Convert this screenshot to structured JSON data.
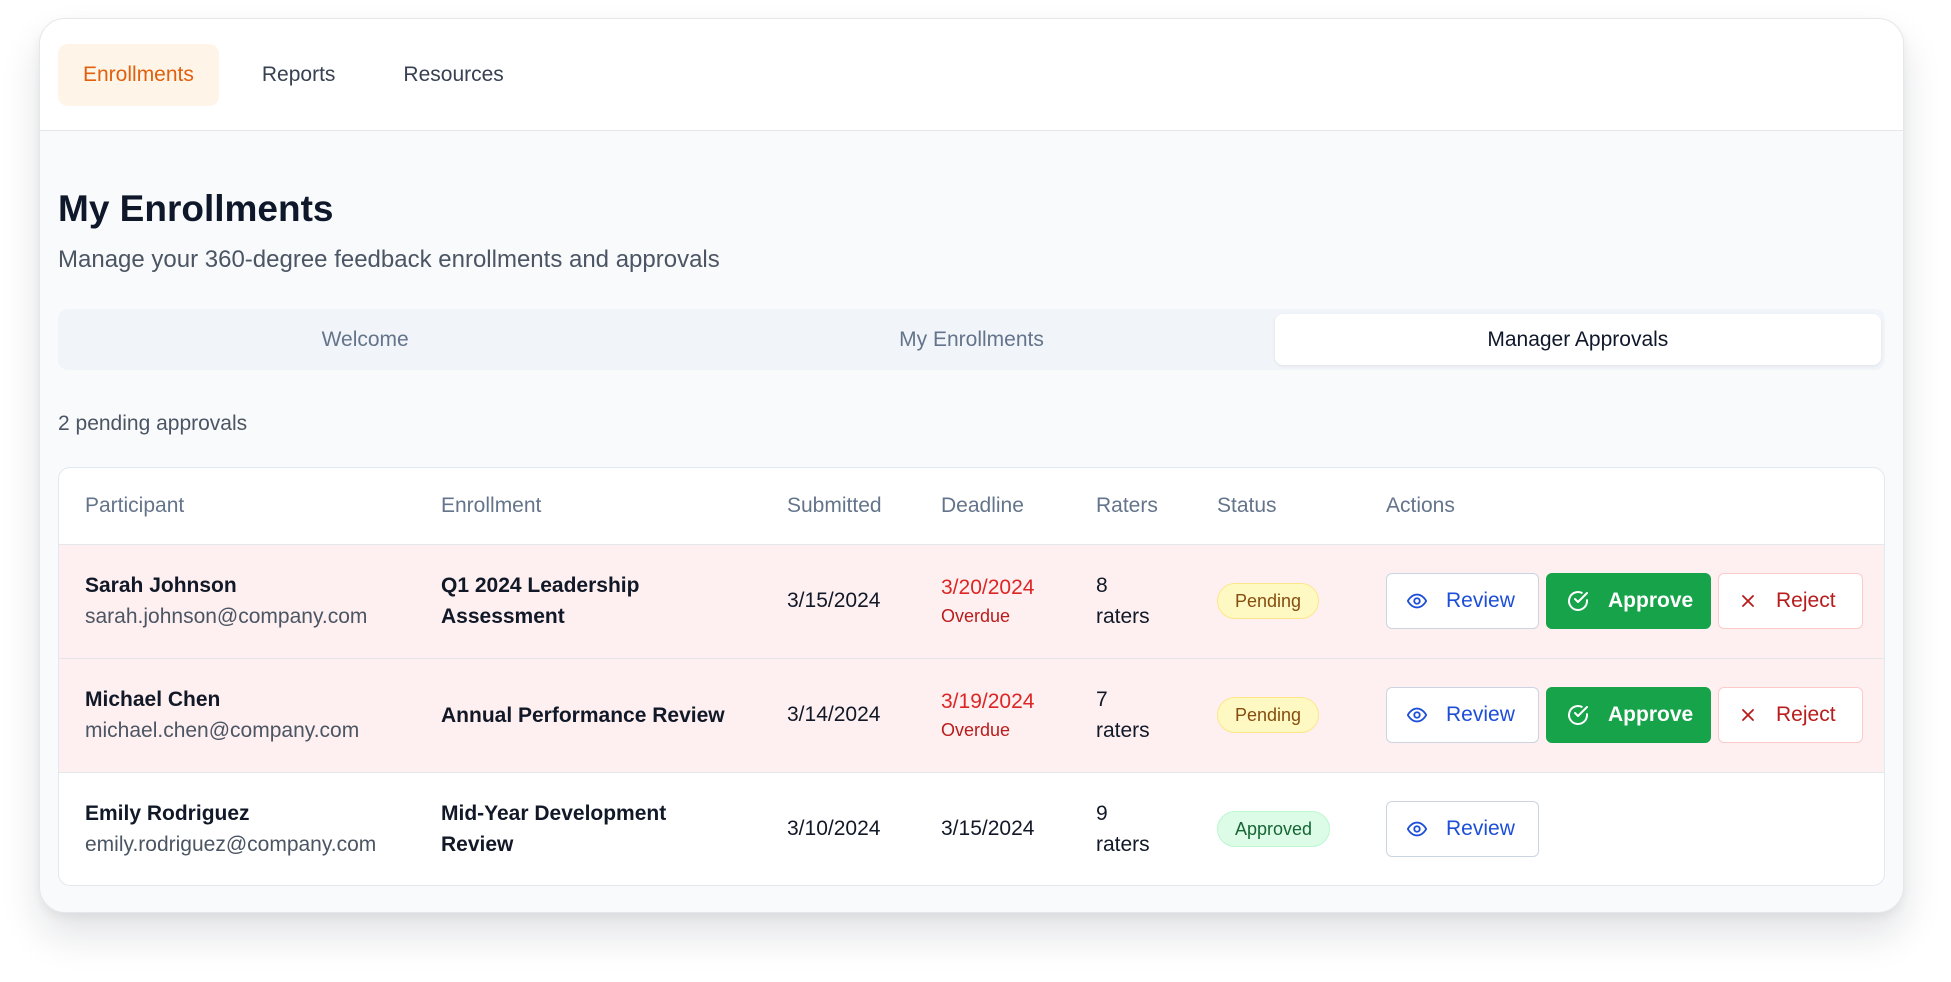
{
  "topnav": {
    "items": [
      {
        "label": "Enrollments",
        "active": true
      },
      {
        "label": "Reports",
        "active": false
      },
      {
        "label": "Resources",
        "active": false
      }
    ]
  },
  "page": {
    "title": "My Enrollments",
    "subtitle": "Manage your 360-degree feedback enrollments and approvals"
  },
  "tabs": [
    {
      "label": "Welcome",
      "active": false
    },
    {
      "label": "My Enrollments",
      "active": false
    },
    {
      "label": "Manager Approvals",
      "active": true
    }
  ],
  "pending_count": "2 pending approvals",
  "table": {
    "headers": {
      "participant": "Participant",
      "enrollment": "Enrollment",
      "submitted": "Submitted",
      "deadline": "Deadline",
      "raters": "Raters",
      "status": "Status",
      "actions": "Actions"
    },
    "rows": [
      {
        "name": "Sarah Johnson",
        "email": "sarah.johnson@company.com",
        "enrollment_line1": "Q1 2024 Leadership",
        "enrollment_line2": "Assessment",
        "submitted": "3/15/2024",
        "deadline": "3/20/2024",
        "deadline_flag": "Overdue",
        "raters_count": "8",
        "raters_unit": "raters",
        "status": "Pending"
      },
      {
        "name": "Michael Chen",
        "email": "michael.chen@company.com",
        "enrollment_line1": "Annual Performance Review",
        "enrollment_line2": "",
        "submitted": "3/14/2024",
        "deadline": "3/19/2024",
        "deadline_flag": "Overdue",
        "raters_count": "7",
        "raters_unit": "raters",
        "status": "Pending"
      },
      {
        "name": "Emily Rodriguez",
        "email": "emily.rodriguez@company.com",
        "enrollment_line1": "Mid-Year Development",
        "enrollment_line2": "Review",
        "submitted": "3/10/2024",
        "deadline": "3/15/2024",
        "deadline_flag": "",
        "raters_count": "9",
        "raters_unit": "raters",
        "status": "Approved"
      }
    ]
  },
  "actions": {
    "review_label": "Review",
    "approve_label": "Approve",
    "reject_label": "Reject"
  },
  "colors": {
    "accent_orange": "#e0610d",
    "approve_green": "#16a34a",
    "review_blue": "#1d4ed8",
    "reject_red": "#b91c1c",
    "overdue_red": "#dc2626",
    "overdue_row_bg": "#fef0f0"
  },
  "icons": {
    "review": "eye-icon",
    "approve": "check-circle-icon",
    "reject": "x-icon"
  }
}
